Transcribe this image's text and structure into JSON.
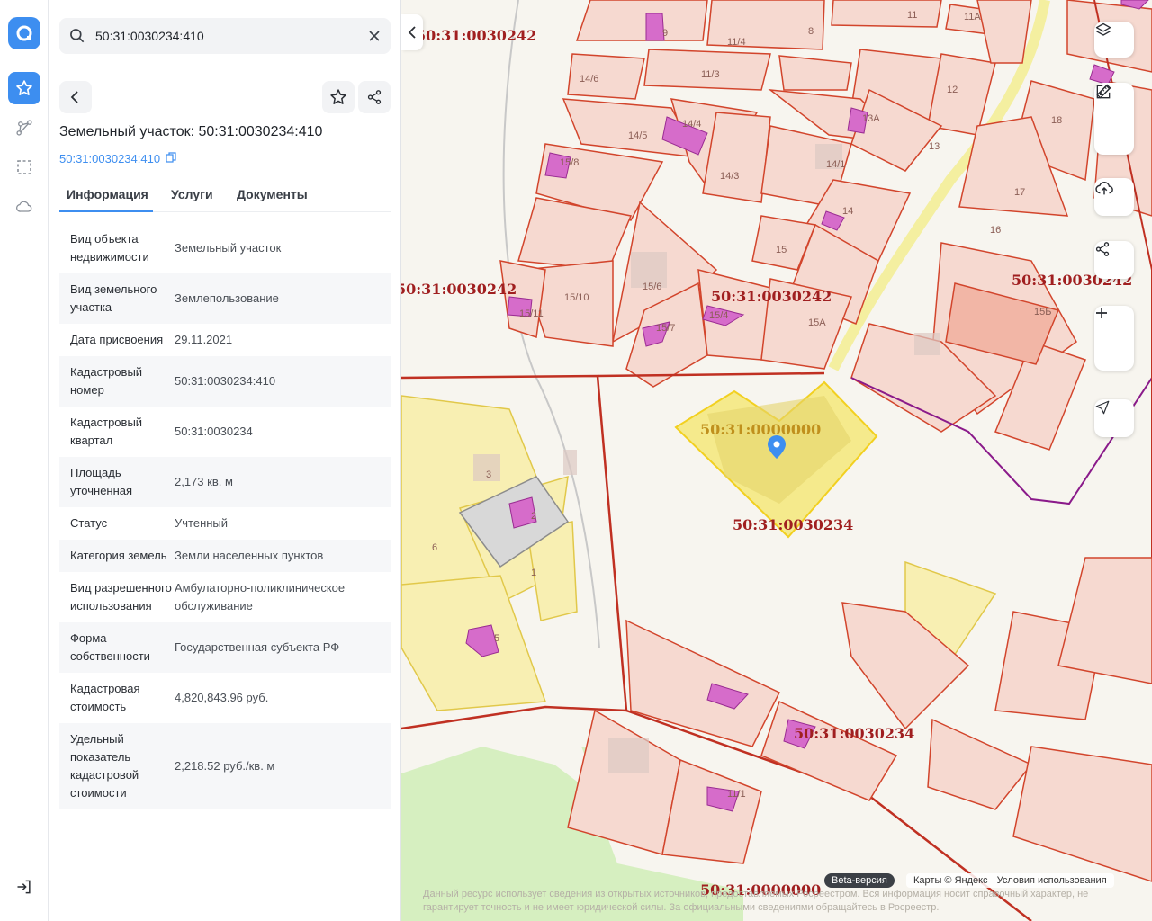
{
  "search": {
    "value": "50:31:0030234:410"
  },
  "header": {
    "title": "Земельный участок: 50:31:0030234:410",
    "cadastral_link": "50:31:0030234:410"
  },
  "tabs": [
    {
      "label": "Информация"
    },
    {
      "label": "Услуги"
    },
    {
      "label": "Документы"
    }
  ],
  "info": [
    {
      "k": "Вид объекта недвижимости",
      "v": "Земельный участок"
    },
    {
      "k": "Вид земельного участка",
      "v": "Землепользование"
    },
    {
      "k": "Дата присвоения",
      "v": "29.11.2021"
    },
    {
      "k": "Кадастровый номер",
      "v": "50:31:0030234:410"
    },
    {
      "k": "Кадастровый квартал",
      "v": "50:31:0030234"
    },
    {
      "k": "Площадь уточненная",
      "v": "2,173 кв. м"
    },
    {
      "k": "Статус",
      "v": "Учтенный"
    },
    {
      "k": "Категория земель",
      "v": "Земли населенных пунктов"
    },
    {
      "k": "Вид разрешенного использования",
      "v": "Амбулаторно-поликлиническое обслуживание"
    },
    {
      "k": "Форма собственности",
      "v": "Государственная субъекта РФ"
    },
    {
      "k": "Кадастровая стоимость",
      "v": "4,820,843.96 руб."
    },
    {
      "k": "Удельный показатель кадастровой стоимости",
      "v": "2,218.52 руб./кв. м"
    }
  ],
  "map": {
    "labels": {
      "q242_a": "50:31:0030242",
      "q242_b": "50:31:0030242",
      "q242_c": "50:31:0030242",
      "q242_d": "50:31:0030242",
      "q000_a": "50:31:0000000",
      "q234_a": "50:31:0030234",
      "q234_b": "50:31:0030234",
      "q000_b": "50:31:0000000"
    },
    "plot_numbers": [
      "9",
      "8",
      "11",
      "11А",
      "11/4",
      "11/3",
      "12",
      "14/6",
      "14/4",
      "14/5",
      "13А",
      "13",
      "18",
      "15/8",
      "14/3",
      "14/1",
      "14",
      "17",
      "16",
      "15",
      "15/6",
      "15/10",
      "15/11",
      "15/4",
      "15/7",
      "15А",
      "15Б",
      "3",
      "2",
      "1",
      "6",
      "5",
      "11/1"
    ],
    "beta_badge": "Beta-версия",
    "copyright": "Карты © Яндекс",
    "terms": "Условия использования",
    "disclaimer": "Данный ресурс использует сведения из открытых источников, предоставляемых Росреестром. Вся информация носит справочный характер, не гарантирует точность и не имеет юридической силы. За официальными сведениями обращайтесь в Росреестр."
  },
  "colors": {
    "accent": "#3d8ef0",
    "plot_fill": "#f6d9d0",
    "plot_stroke": "#d2452c",
    "selected_fill": "#f5e87a",
    "building": "#d066c8"
  }
}
